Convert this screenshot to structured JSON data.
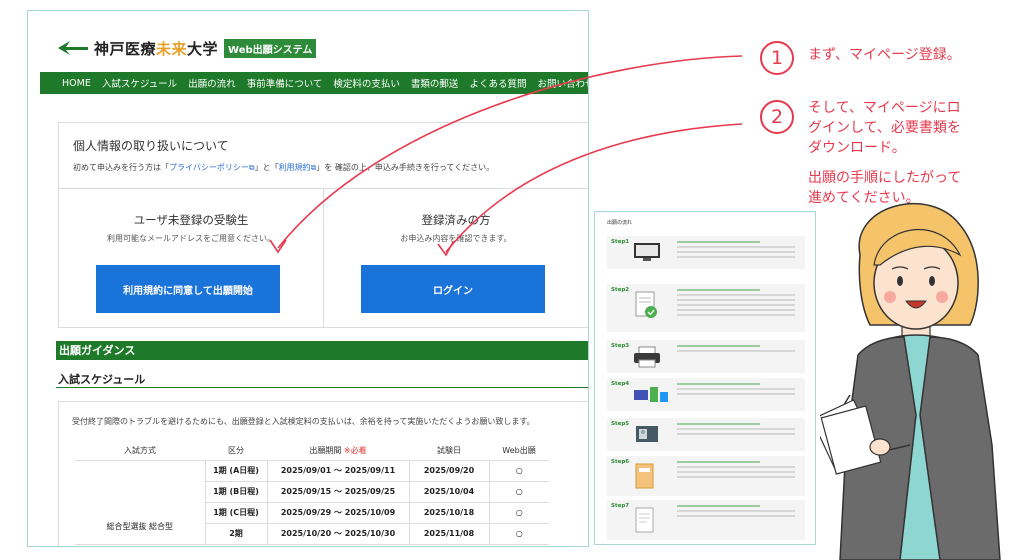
{
  "site": {
    "logo_main": "神戸医療",
    "logo_accent": "未来",
    "logo_end": "大学",
    "badge": "Web出願システム"
  },
  "nav": [
    "HOME",
    "入試スケジュール",
    "出願の流れ",
    "事前準備について",
    "検定料の支払い",
    "書類の郵送",
    "よくある質問",
    "お問い合わせ"
  ],
  "privacy": {
    "title": "個人情報の取り扱いについて",
    "note_pre": "初めて申込みを行う方は「",
    "link1": "プライバシーポリシー",
    "note_mid": "」と「",
    "link2": "利用規約",
    "note_post": "」を 確認の上、申込み手続きを行ってください。"
  },
  "panels": {
    "new": {
      "title": "ユーザ未登録の受験生",
      "sub": "利用可能なメールアドレスをご用意ください。",
      "button": "利用規約に同意して出願開始"
    },
    "registered": {
      "title": "登録済みの方",
      "sub": "お申込み内容を確認できます。",
      "button": "ログイン"
    }
  },
  "guidance": "出願ガイダンス",
  "schedule": {
    "heading": "入試スケジュール",
    "note": "受付終了間際のトラブルを避けるためにも、出願登録と入試検定料の支払いは、余裕を持って実施いただくようお願い致します。",
    "headers": [
      "入試方式",
      "区分",
      "出願期間",
      "※必着",
      "試験日",
      "Web出願"
    ],
    "method": "総合型選抜 総合型",
    "rows": [
      {
        "term": "1期 (A日程)",
        "period": "2025/09/01 ～ 2025/09/11",
        "exam": "2025/09/20",
        "web": "○"
      },
      {
        "term": "1期 (B日程)",
        "period": "2025/09/15 ～ 2025/09/25",
        "exam": "2025/10/04",
        "web": "○"
      },
      {
        "term": "1期 (C日程)",
        "period": "2025/09/29 ～ 2025/10/09",
        "exam": "2025/10/18",
        "web": "○"
      },
      {
        "term": "2期",
        "period": "2025/10/20 ～ 2025/10/30",
        "exam": "2025/11/08",
        "web": "○"
      }
    ]
  },
  "annotations": {
    "step1_num": "1",
    "step1_text": "まず、マイページ登録。",
    "step2_num": "2",
    "step2_lines": [
      "そして、マイページにロ",
      "グインして、必要書類を",
      "ダウンロード。"
    ],
    "step3_lines": [
      "出願の手順にしたがって",
      "進めてください。"
    ]
  },
  "flow": {
    "title": "出願の流れ",
    "steps": [
      "Step1",
      "Step2",
      "Step3",
      "Step4",
      "Step5",
      "Step6",
      "Step7"
    ]
  },
  "colors": {
    "brand_green": "#1e7a2a",
    "button_blue": "#1a73d9",
    "annotation_red": "#e63a4e"
  }
}
